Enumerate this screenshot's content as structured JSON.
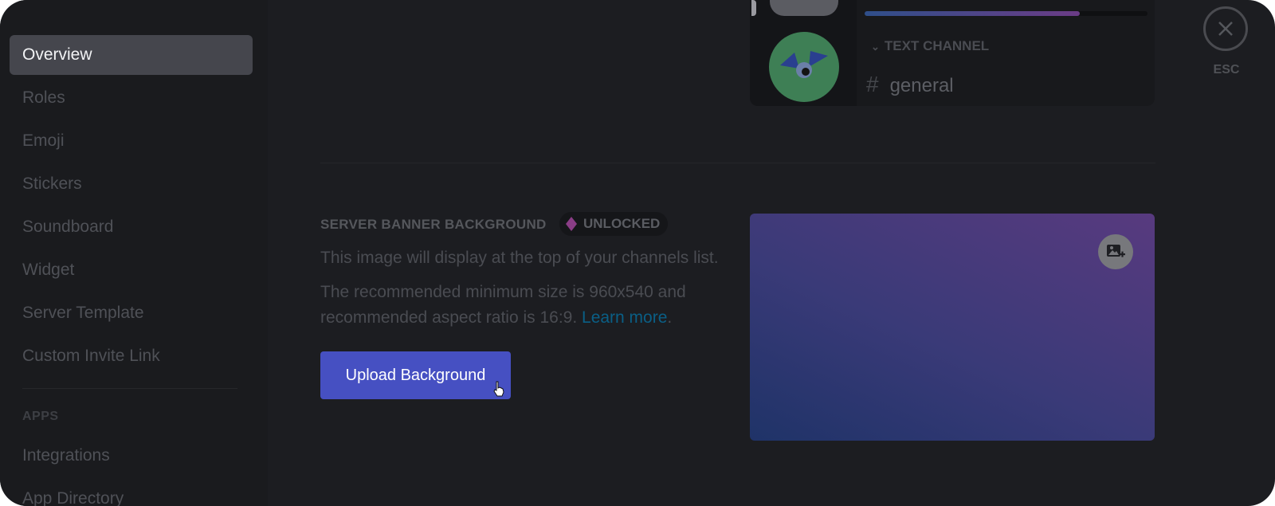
{
  "sidebar": {
    "items": [
      {
        "label": "Overview"
      },
      {
        "label": "Roles"
      },
      {
        "label": "Emoji"
      },
      {
        "label": "Stickers"
      },
      {
        "label": "Soundboard"
      },
      {
        "label": "Widget"
      },
      {
        "label": "Server Template"
      },
      {
        "label": "Custom Invite Link"
      }
    ],
    "apps_header": "APPS",
    "apps_items": [
      {
        "label": "Integrations"
      },
      {
        "label": "App Directory"
      }
    ]
  },
  "preview": {
    "boost_progress": 0.76,
    "channel_category": "TEXT CHANNEL",
    "channel_name": "general"
  },
  "banner": {
    "title": "SERVER BANNER BACKGROUND",
    "badge": "UNLOCKED",
    "desc1": "This image will display at the top of your channels list.",
    "desc2": "The recommended minimum size is 960x540 and recommended aspect ratio is 16:9.",
    "learn_more": "Learn more",
    "desc2_end": ".",
    "upload_label": "Upload Background"
  },
  "close": {
    "label": "ESC"
  },
  "colors": {
    "accent": "#4650c2",
    "link": "#0a5f86",
    "badge_gem": "#8a3d86"
  },
  "icons": [
    "gem-icon",
    "hash-icon",
    "chevron-down-icon",
    "add-image-icon",
    "close-icon",
    "hand-cursor-icon"
  ]
}
